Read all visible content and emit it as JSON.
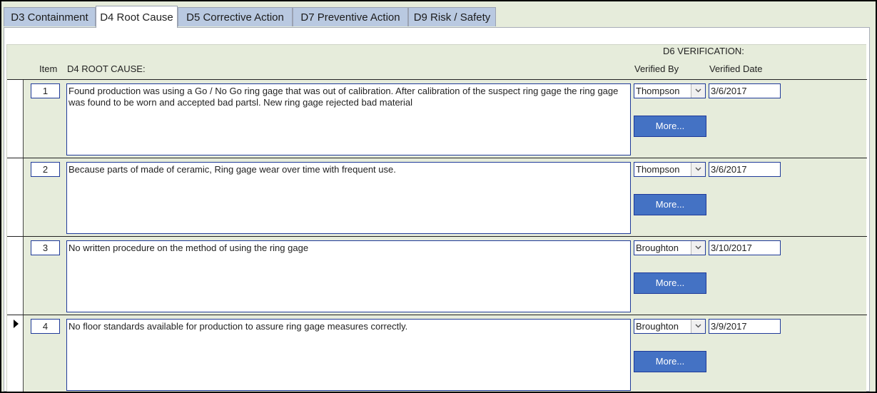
{
  "tabs": [
    {
      "label": "D3 Containment",
      "active": false
    },
    {
      "label": "D4 Root Cause",
      "active": true
    },
    {
      "label": "D5 Corrective Action",
      "active": false
    },
    {
      "label": "D7 Preventive Action",
      "active": false
    },
    {
      "label": "D9 Risk / Safety",
      "active": false
    }
  ],
  "headers": {
    "verification": "D6  VERIFICATION:",
    "item": "Item",
    "root_cause": "D4  ROOT CAUSE:",
    "verified_by": "Verified By",
    "verified_date": "Verified Date"
  },
  "rows": [
    {
      "item": "1",
      "cause": "Found production was using a  Go / No Go ring gage that was out of calibration. After calibration of the suspect ring gage the ring gage was found to be worn and accepted bad partsl. New ring gage rejected bad material",
      "verified_by": "Thompson",
      "verified_date": "3/6/2017",
      "more_label": "More...",
      "current": false
    },
    {
      "item": "2",
      "cause": "Because parts of made of ceramic, Ring gage wear over time with frequent use.",
      "verified_by": "Thompson",
      "verified_date": "3/6/2017",
      "more_label": "More...",
      "current": false
    },
    {
      "item": "3",
      "cause": "No written procedure on the method of using the ring gage",
      "verified_by": "Broughton",
      "verified_date": "3/10/2017",
      "more_label": "More...",
      "current": false
    },
    {
      "item": "4",
      "cause": "No floor standards available for production to assure ring gage measures correctly.",
      "verified_by": "Broughton",
      "verified_date": "3/9/2017",
      "more_label": "More...",
      "current": true
    }
  ],
  "icons": {
    "dropdown": "chevron-down-icon",
    "record_selector": "current-record-arrow-icon"
  },
  "colors": {
    "background": "#e6ecdb",
    "tab_inactive": "#b9c9e1",
    "button": "#4472c4",
    "field_border": "#1f3a99"
  }
}
